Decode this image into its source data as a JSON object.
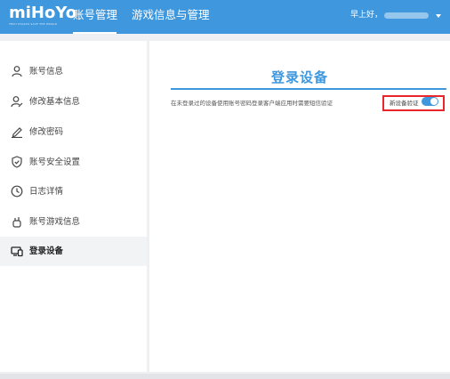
{
  "header": {
    "logo_text": "miHoYo",
    "logo_tagline": "TECH OTAKUS SAVE THE WORLD",
    "nav": [
      {
        "label": "账号管理",
        "active": true
      },
      {
        "label": "游戏信息与管理",
        "active": false
      }
    ],
    "greeting": "早上好，",
    "accent_color": "#3f97dd"
  },
  "sidebar": {
    "items": [
      {
        "label": "账号信息",
        "icon": "user-icon"
      },
      {
        "label": "修改基本信息",
        "icon": "user-edit-icon"
      },
      {
        "label": "修改密码",
        "icon": "pencil-icon"
      },
      {
        "label": "账号安全设置",
        "icon": "shield-check-icon"
      },
      {
        "label": "日志详情",
        "icon": "clock-icon"
      },
      {
        "label": "账号游戏信息",
        "icon": "game-controller-icon"
      },
      {
        "label": "登录设备",
        "icon": "devices-icon",
        "active": true
      }
    ]
  },
  "main": {
    "title": "登录设备",
    "description": "在未登录过的设备使用账号密码登录客户端应用时需要短信验证",
    "toggle": {
      "label": "新设备验证",
      "on": true
    },
    "highlight_color": "#e8262b"
  }
}
